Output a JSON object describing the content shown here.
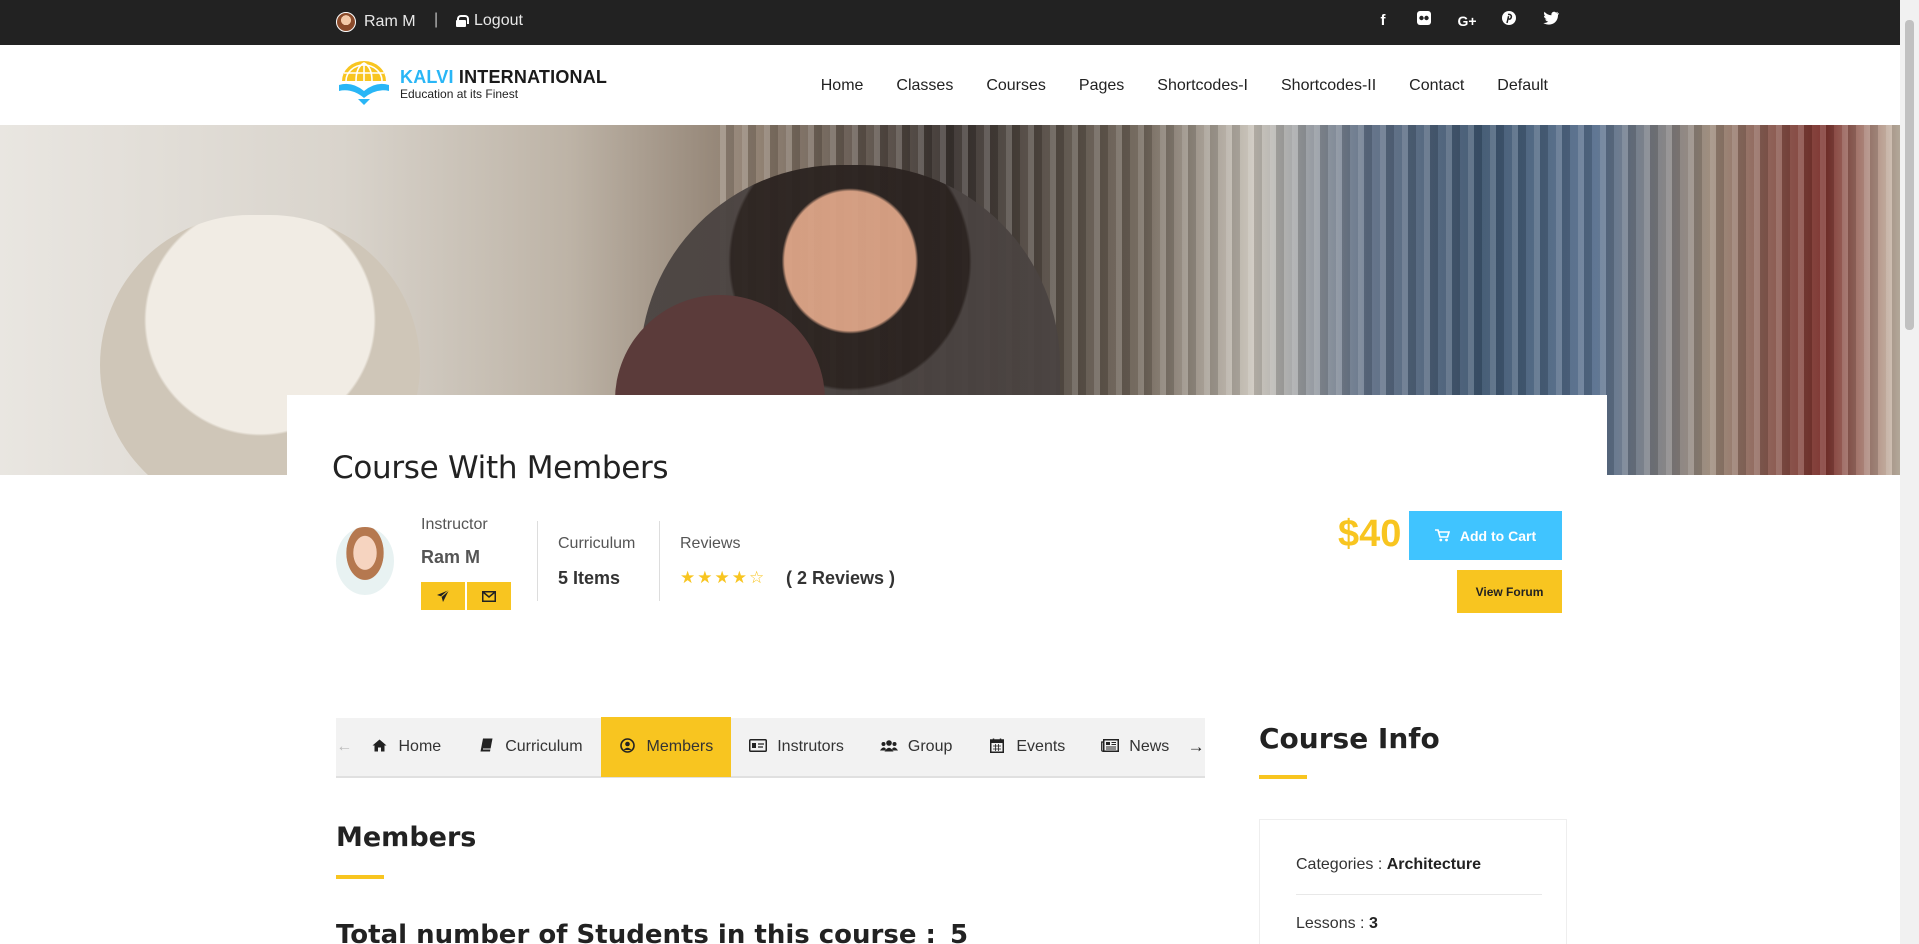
{
  "topbar": {
    "user_name": "Ram M",
    "separator": "|",
    "logout_label": "Logout",
    "social": [
      "f",
      "✿",
      "G+",
      "℗",
      "🐦"
    ]
  },
  "header": {
    "logo_brand_1": "KALVI",
    "logo_brand_2": " INTERNATIONAL",
    "logo_tagline": "Education at its Finest",
    "nav": [
      "Home",
      "Classes",
      "Courses",
      "Pages",
      "Shortcodes-I",
      "Shortcodes-II",
      "Contact",
      "Default"
    ]
  },
  "course": {
    "title": "Course With Members",
    "instructor_label": "Instructor",
    "instructor_name": "Ram M",
    "curriculum_label": "Curriculum",
    "curriculum_value": "5 Items",
    "reviews_label": "Reviews",
    "stars": "★★★★☆",
    "reviews_count": "( 2 Reviews )",
    "rating": 4.5,
    "price": "$40",
    "add_to_cart": "Add to Cart",
    "view_forum": "View Forum"
  },
  "tabs": {
    "items": [
      {
        "label": "Home",
        "icon": "home-icon"
      },
      {
        "label": "Curriculum",
        "icon": "book-icon"
      },
      {
        "label": "Members",
        "icon": "user-circle-icon"
      },
      {
        "label": "Instrutors",
        "icon": "id-card-icon"
      },
      {
        "label": "Group",
        "icon": "users-icon"
      },
      {
        "label": "Events",
        "icon": "calendar-icon"
      },
      {
        "label": "News",
        "icon": "newspaper-icon"
      }
    ],
    "active": "Members"
  },
  "members": {
    "title": "Members",
    "total_label": "Total number of Students in this course :",
    "total_value": "5"
  },
  "course_info": {
    "title": "Course Info",
    "categories_label": "Categories : ",
    "categories_value": "Architecture",
    "lessons_label": "Lessons : ",
    "lessons_value": "3"
  },
  "colors": {
    "accent_yellow": "#f8c520",
    "accent_blue": "#40c4ff",
    "topbar_bg": "#222222"
  }
}
